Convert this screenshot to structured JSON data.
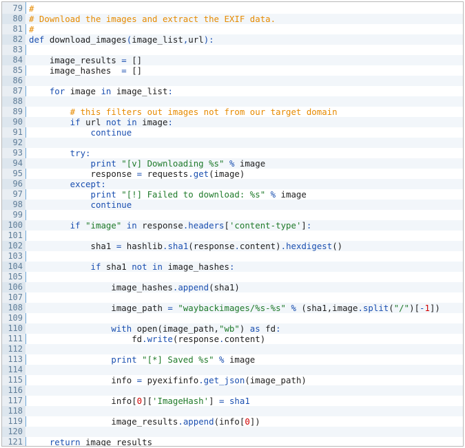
{
  "editor": {
    "lines": [
      {
        "n": "79",
        "tokens": [
          [
            "c",
            "#"
          ]
        ]
      },
      {
        "n": "80",
        "tokens": [
          [
            "c",
            "# Download the images and extract the EXIF data."
          ]
        ]
      },
      {
        "n": "81",
        "tokens": [
          [
            "c",
            "#"
          ]
        ]
      },
      {
        "n": "82",
        "tokens": [
          [
            "k",
            "def "
          ],
          [
            "d",
            "download_images"
          ],
          [
            "k",
            "("
          ],
          [
            "d",
            "image_list"
          ],
          [
            "k",
            ","
          ],
          [
            "d",
            "url"
          ],
          [
            "k",
            "):"
          ]
        ]
      },
      {
        "n": "83",
        "tokens": []
      },
      {
        "n": "84",
        "tokens": [
          [
            "d",
            "    image_results "
          ],
          [
            "o",
            "="
          ],
          [
            "d",
            " []"
          ]
        ]
      },
      {
        "n": "85",
        "tokens": [
          [
            "d",
            "    image_hashes  "
          ],
          [
            "o",
            "="
          ],
          [
            "d",
            " []"
          ]
        ]
      },
      {
        "n": "86",
        "tokens": []
      },
      {
        "n": "87",
        "tokens": [
          [
            "k",
            "    for "
          ],
          [
            "d",
            "image "
          ],
          [
            "k",
            "in "
          ],
          [
            "d",
            "image_list"
          ],
          [
            "k",
            ":"
          ]
        ]
      },
      {
        "n": "88",
        "tokens": []
      },
      {
        "n": "89",
        "tokens": [
          [
            "c",
            "        # this filters out images not from our target domain"
          ]
        ]
      },
      {
        "n": "90",
        "tokens": [
          [
            "k",
            "        if "
          ],
          [
            "d",
            "url "
          ],
          [
            "k",
            "not in "
          ],
          [
            "d",
            "image"
          ],
          [
            "k",
            ":"
          ]
        ]
      },
      {
        "n": "91",
        "tokens": [
          [
            "k",
            "            continue"
          ]
        ]
      },
      {
        "n": "92",
        "tokens": []
      },
      {
        "n": "93",
        "tokens": [
          [
            "k",
            "        try:"
          ]
        ]
      },
      {
        "n": "94",
        "tokens": [
          [
            "k",
            "            print "
          ],
          [
            "s",
            "\"[v] Downloading %s\""
          ],
          [
            "o",
            " % "
          ],
          [
            "d",
            "image"
          ]
        ]
      },
      {
        "n": "95",
        "tokens": [
          [
            "d",
            "            response "
          ],
          [
            "o",
            "="
          ],
          [
            "d",
            " requests"
          ],
          [
            "o",
            "."
          ],
          [
            "k",
            "get"
          ],
          [
            "d",
            "(image)"
          ]
        ]
      },
      {
        "n": "96",
        "tokens": [
          [
            "k",
            "        except:"
          ]
        ]
      },
      {
        "n": "97",
        "tokens": [
          [
            "k",
            "            print "
          ],
          [
            "s",
            "\"[!] Failed to download: %s\""
          ],
          [
            "o",
            " % "
          ],
          [
            "d",
            "image"
          ]
        ]
      },
      {
        "n": "98",
        "tokens": [
          [
            "k",
            "            continue"
          ]
        ]
      },
      {
        "n": "99",
        "tokens": []
      },
      {
        "n": "100",
        "tokens": [
          [
            "k",
            "        if "
          ],
          [
            "s",
            "\"image\""
          ],
          [
            "k",
            " in "
          ],
          [
            "d",
            "response"
          ],
          [
            "o",
            "."
          ],
          [
            "k",
            "headers"
          ],
          [
            "d",
            "["
          ],
          [
            "s",
            "'content-type'"
          ],
          [
            "d",
            "]"
          ],
          [
            "k",
            ":"
          ]
        ]
      },
      {
        "n": "101",
        "tokens": []
      },
      {
        "n": "102",
        "tokens": [
          [
            "d",
            "            sha1 "
          ],
          [
            "o",
            "="
          ],
          [
            "d",
            " hashlib"
          ],
          [
            "o",
            "."
          ],
          [
            "k",
            "sha1"
          ],
          [
            "d",
            "(response"
          ],
          [
            "o",
            "."
          ],
          [
            "d",
            "content)"
          ],
          [
            "o",
            "."
          ],
          [
            "k",
            "hexdigest"
          ],
          [
            "d",
            "()"
          ]
        ]
      },
      {
        "n": "103",
        "tokens": []
      },
      {
        "n": "104",
        "tokens": [
          [
            "k",
            "            if "
          ],
          [
            "d",
            "sha1 "
          ],
          [
            "k",
            "not in "
          ],
          [
            "d",
            "image_hashes"
          ],
          [
            "k",
            ":"
          ]
        ]
      },
      {
        "n": "105",
        "tokens": []
      },
      {
        "n": "106",
        "tokens": [
          [
            "d",
            "                image_hashes"
          ],
          [
            "o",
            "."
          ],
          [
            "k",
            "append"
          ],
          [
            "d",
            "(sha1)"
          ]
        ]
      },
      {
        "n": "107",
        "tokens": []
      },
      {
        "n": "108",
        "tokens": [
          [
            "d",
            "                image_path "
          ],
          [
            "o",
            "="
          ],
          [
            "s",
            " \"waybackimages/%s-%s\""
          ],
          [
            "o",
            " % "
          ],
          [
            "d",
            "(sha1,image"
          ],
          [
            "o",
            "."
          ],
          [
            "k",
            "split"
          ],
          [
            "d",
            "("
          ],
          [
            "s",
            "\"/\""
          ],
          [
            "d",
            ")["
          ],
          [
            "o",
            "-"
          ],
          [
            "n",
            "1"
          ],
          [
            "d",
            "])"
          ]
        ]
      },
      {
        "n": "109",
        "tokens": []
      },
      {
        "n": "110",
        "tokens": [
          [
            "k",
            "                with "
          ],
          [
            "d",
            "open(image_path,"
          ],
          [
            "s",
            "\"wb\""
          ],
          [
            "d",
            ") "
          ],
          [
            "k",
            "as "
          ],
          [
            "d",
            "fd"
          ],
          [
            "k",
            ":"
          ]
        ]
      },
      {
        "n": "111",
        "tokens": [
          [
            "d",
            "                    fd"
          ],
          [
            "o",
            "."
          ],
          [
            "k",
            "write"
          ],
          [
            "d",
            "(response"
          ],
          [
            "o",
            "."
          ],
          [
            "d",
            "content)"
          ]
        ]
      },
      {
        "n": "112",
        "tokens": []
      },
      {
        "n": "113",
        "tokens": [
          [
            "k",
            "                print "
          ],
          [
            "s",
            "\"[*] Saved %s\""
          ],
          [
            "o",
            " % "
          ],
          [
            "d",
            "image"
          ]
        ]
      },
      {
        "n": "114",
        "tokens": []
      },
      {
        "n": "115",
        "tokens": [
          [
            "d",
            "                info "
          ],
          [
            "o",
            "="
          ],
          [
            "d",
            " pyexifinfo"
          ],
          [
            "o",
            "."
          ],
          [
            "k",
            "get_json"
          ],
          [
            "d",
            "(image_path)"
          ]
        ]
      },
      {
        "n": "116",
        "tokens": []
      },
      {
        "n": "117",
        "tokens": [
          [
            "d",
            "                info["
          ],
          [
            "n",
            "0"
          ],
          [
            "d",
            "]["
          ],
          [
            "s",
            "'ImageHash'"
          ],
          [
            "d",
            "] "
          ],
          [
            "o",
            "="
          ],
          [
            "k",
            " sha1"
          ]
        ]
      },
      {
        "n": "118",
        "tokens": []
      },
      {
        "n": "119",
        "tokens": [
          [
            "d",
            "                image_results"
          ],
          [
            "o",
            "."
          ],
          [
            "k",
            "append"
          ],
          [
            "d",
            "(info["
          ],
          [
            "n",
            "0"
          ],
          [
            "d",
            "])"
          ]
        ]
      },
      {
        "n": "120",
        "tokens": []
      },
      {
        "n": "121",
        "tokens": [
          [
            "k",
            "    return "
          ],
          [
            "d",
            "image_results"
          ]
        ]
      }
    ]
  }
}
